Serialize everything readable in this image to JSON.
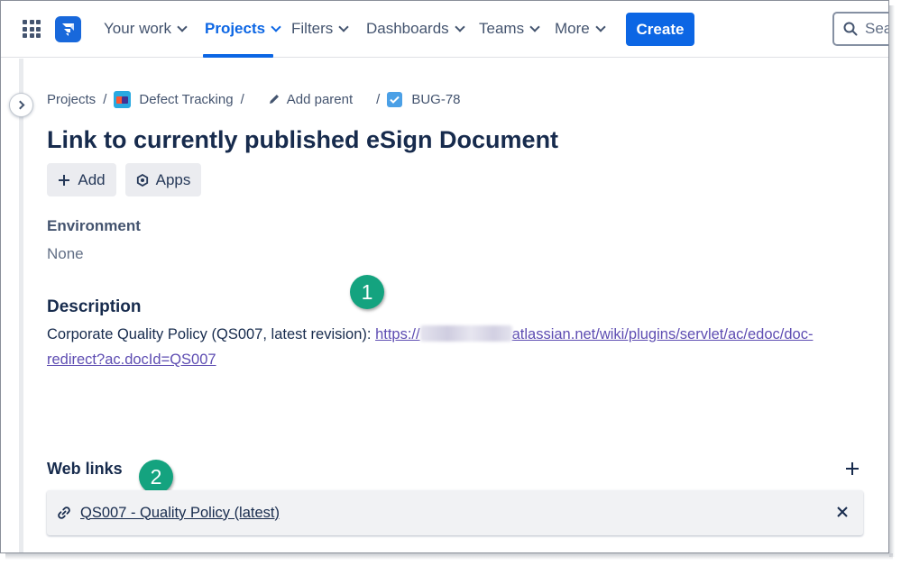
{
  "nav": {
    "your_work": "Your work",
    "projects": "Projects",
    "filters": "Filters",
    "dashboards": "Dashboards",
    "teams": "Teams",
    "more": "More",
    "create": "Create",
    "search_placeholder": "Search"
  },
  "breadcrumb": {
    "projects": "Projects",
    "project_name": "Defect Tracking",
    "add_parent": "Add parent",
    "issue_key": "BUG-78"
  },
  "issue": {
    "title": "Link to currently published eSign Document",
    "add_button": "Add",
    "apps_button": "Apps",
    "environment_label": "Environment",
    "environment_value": "None",
    "description_label": "Description",
    "description_text": "Corporate Quality Policy (QS007, latest revision): ",
    "description_link_prefix": "https://",
    "description_link_rest": "atlassian.net/wiki/plugins/servlet/ac/edoc/doc-redirect?ac.docId=QS007"
  },
  "web_links": {
    "label": "Web links",
    "items": [
      {
        "text": "QS007 - Quality Policy (latest)"
      }
    ]
  },
  "callouts": [
    "1",
    "2"
  ],
  "colors": {
    "accent": "#0c66e4",
    "link": "#5e4db2",
    "callout": "#14a37f"
  }
}
